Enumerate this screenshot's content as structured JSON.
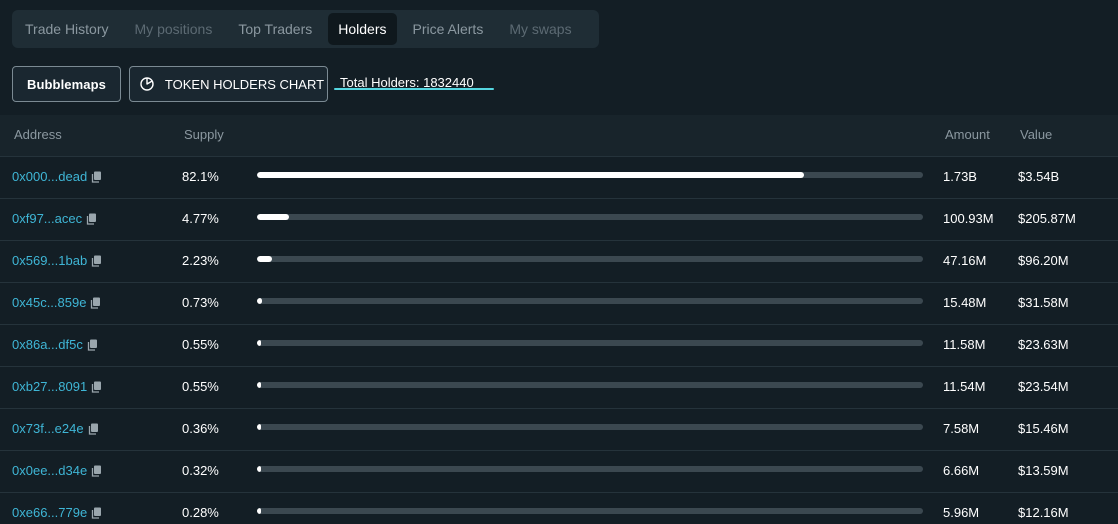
{
  "tabs": [
    {
      "label": "Trade History",
      "state": "normal"
    },
    {
      "label": "My positions",
      "state": "dim"
    },
    {
      "label": "Top Traders",
      "state": "normal"
    },
    {
      "label": "Holders",
      "state": "active"
    },
    {
      "label": "Price Alerts",
      "state": "normal"
    },
    {
      "label": "My swaps",
      "state": "dim"
    }
  ],
  "toolbar": {
    "bubblemaps_label": "Bubblemaps",
    "chart_label": "TOKEN HOLDERS CHART",
    "chart_icon": "pie-chart-icon",
    "total_holders": "Total Holders: 1832440"
  },
  "table": {
    "headers": {
      "address": "Address",
      "supply": "Supply",
      "amount": "Amount",
      "value": "Value"
    },
    "rows": [
      {
        "address": "0x000...dead",
        "supply": "82.1%",
        "fraction": 0.821,
        "amount": "1.73B",
        "value": "$3.54B"
      },
      {
        "address": "0xf97...acec",
        "supply": "4.77%",
        "fraction": 0.0477,
        "amount": "100.93M",
        "value": "$205.87M"
      },
      {
        "address": "0x569...1bab",
        "supply": "2.23%",
        "fraction": 0.0223,
        "amount": "47.16M",
        "value": "$96.20M"
      },
      {
        "address": "0x45c...859e",
        "supply": "0.73%",
        "fraction": 0.0073,
        "amount": "15.48M",
        "value": "$31.58M"
      },
      {
        "address": "0x86a...df5c",
        "supply": "0.55%",
        "fraction": 0.0055,
        "amount": "11.58M",
        "value": "$23.63M"
      },
      {
        "address": "0xb27...8091",
        "supply": "0.55%",
        "fraction": 0.0055,
        "amount": "11.54M",
        "value": "$23.54M"
      },
      {
        "address": "0x73f...e24e",
        "supply": "0.36%",
        "fraction": 0.0036,
        "amount": "7.58M",
        "value": "$15.46M"
      },
      {
        "address": "0x0ee...d34e",
        "supply": "0.32%",
        "fraction": 0.0032,
        "amount": "6.66M",
        "value": "$13.59M"
      },
      {
        "address": "0xe66...779e",
        "supply": "0.28%",
        "fraction": 0.0028,
        "amount": "5.96M",
        "value": "$12.16M"
      }
    ]
  },
  "colors": {
    "background": "#131e25",
    "link": "#3fb6d6",
    "accent_underline": "#55d6e0",
    "bar_fill": "#ffffff",
    "bar_track": "#3b4850"
  }
}
